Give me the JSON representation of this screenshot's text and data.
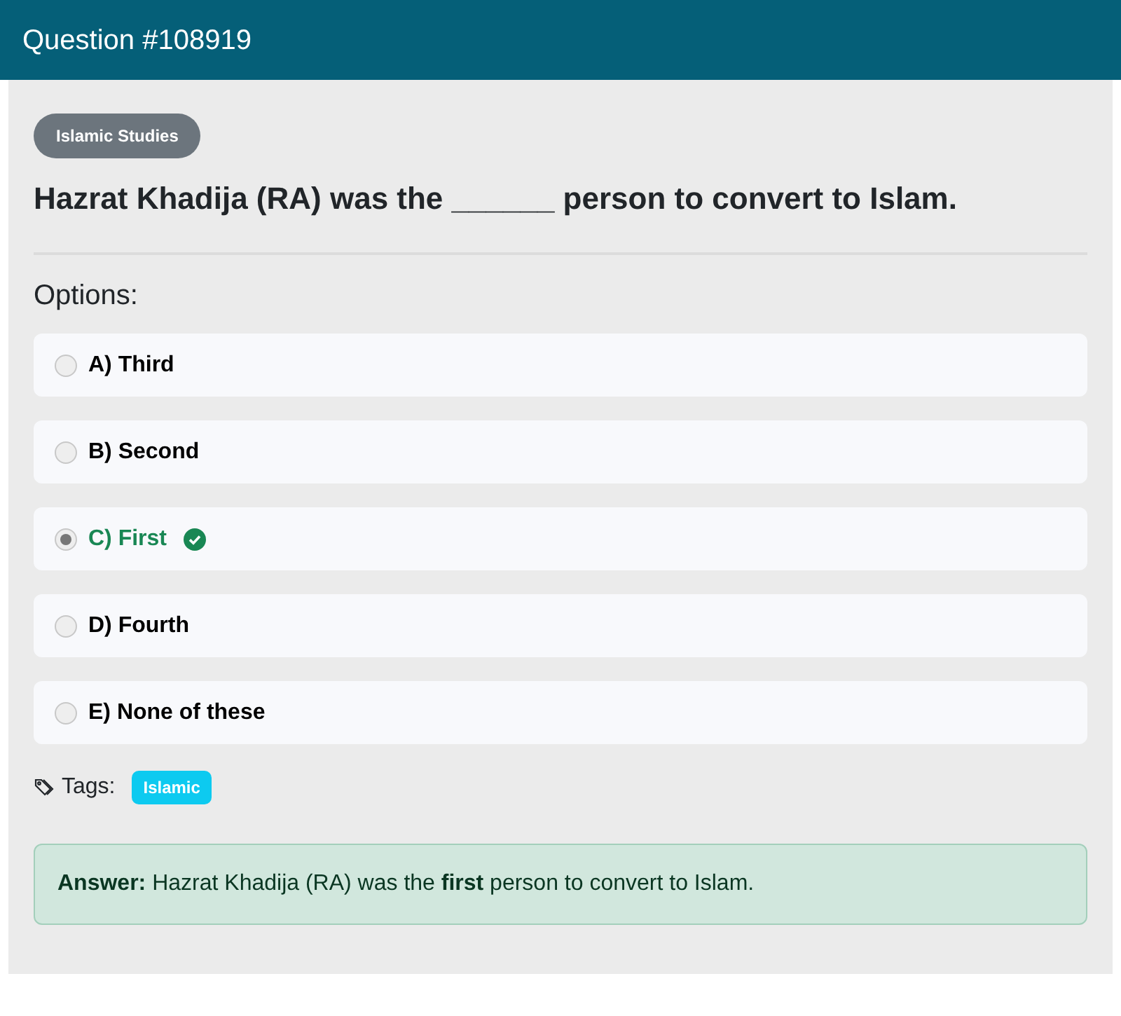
{
  "header": {
    "title": "Question #108919"
  },
  "category": "Islamic Studies",
  "question": "Hazrat Khadija (RA) was the ______ person to convert to Islam.",
  "options_label": "Options:",
  "options": [
    {
      "label": "A) Third",
      "selected": false,
      "correct": false
    },
    {
      "label": "B) Second",
      "selected": false,
      "correct": false
    },
    {
      "label": "C) First",
      "selected": true,
      "correct": true
    },
    {
      "label": "D) Fourth",
      "selected": false,
      "correct": false
    },
    {
      "label": "E) None of these",
      "selected": false,
      "correct": false
    }
  ],
  "tags_label": "Tags:",
  "tags": [
    "Islamic"
  ],
  "answer": "**Answer:** Hazrat Khadija (RA) was the **first** person to convert to Islam."
}
